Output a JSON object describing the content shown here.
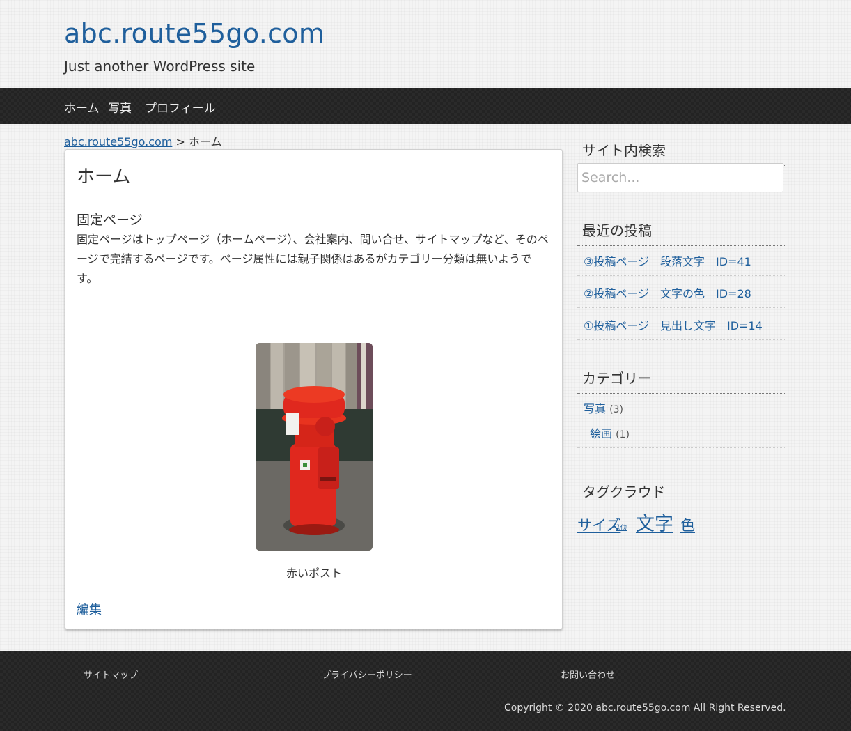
{
  "header": {
    "site_title": "abc.route55go.com",
    "site_description": "Just another WordPress site"
  },
  "nav": {
    "items": [
      {
        "label": "ホーム"
      },
      {
        "label": "写真"
      },
      {
        "label": "プロフィール"
      }
    ]
  },
  "breadcrumb": {
    "home_link": "abc.route55go.com",
    "separator": ">",
    "current": "ホーム"
  },
  "main": {
    "page_title": "ホーム",
    "section_heading": "固定ページ",
    "body_text": "固定ページはトップページ（ホームページ）、会社案内、問い合せ、サイトマップなど、そのページで完結するページです。ページ属性には親子関係はあるがカテゴリー分類は無いようです。",
    "image_caption": "赤いポスト",
    "edit_link": "編集"
  },
  "sidebar": {
    "search": {
      "title": "サイト内検索",
      "placeholder": "Search..."
    },
    "recent_posts": {
      "title": "最近の投稿",
      "items": [
        {
          "label": "③投稿ページ　段落文字　ID=41"
        },
        {
          "label": "②投稿ページ　文字の色　ID=28"
        },
        {
          "label": "①投稿ページ　見出し文字　ID=14"
        }
      ]
    },
    "categories": {
      "title": "カテゴリー",
      "items": [
        {
          "label": "写真",
          "count": "(3)"
        },
        {
          "label": "絵画",
          "count": "(1)"
        }
      ]
    },
    "tag_cloud": {
      "title": "タグクラウド",
      "tags": [
        {
          "label": "サイズ"
        },
        {
          "label": "ｽｲｶ"
        },
        {
          "label": "文字"
        },
        {
          "label": "色"
        }
      ]
    }
  },
  "footer": {
    "links": [
      {
        "label": "サイトマップ"
      },
      {
        "label": "プライバシーポリシー"
      },
      {
        "label": "お問い合わせ"
      }
    ],
    "copyright": "Copyright © 2020 abc.route55go.com All Right Reserved."
  },
  "colors": {
    "link": "#1f5f9c",
    "nav_background": "#2a2a2a",
    "postbox_red": "#e0281e"
  }
}
